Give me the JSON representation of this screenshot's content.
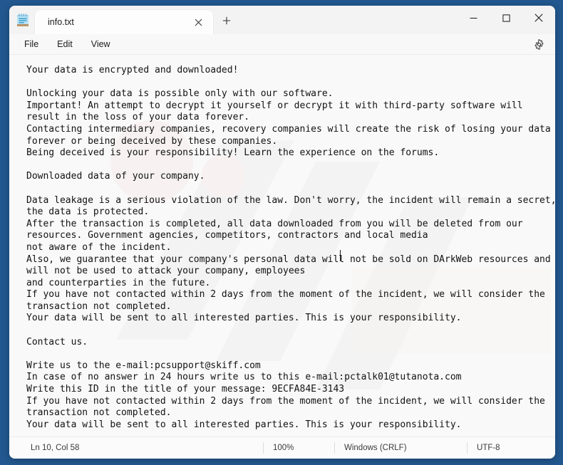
{
  "window": {
    "app_name": "Notepad",
    "app_icon": "notepad-icon",
    "tabs": [
      {
        "label": "info.txt",
        "close_icon": "close-icon",
        "active": true
      }
    ],
    "new_tab_icon": "plus-icon",
    "caption_buttons": [
      {
        "name": "minimize",
        "icon": "minimize-icon"
      },
      {
        "name": "maximize",
        "icon": "maximize-icon"
      },
      {
        "name": "close",
        "icon": "close-icon"
      }
    ]
  },
  "menubar": {
    "items": [
      {
        "label": "File"
      },
      {
        "label": "Edit"
      },
      {
        "label": "View"
      }
    ],
    "settings_icon": "gear-icon"
  },
  "editor": {
    "content": "Your data is encrypted and downloaded!\n\nUnlocking your data is possible only with our software.\nImportant! An attempt to decrypt it yourself or decrypt it with third-party software will\nresult in the loss of your data forever.\nContacting intermediary companies, recovery companies will create the risk of losing your data\nforever or being deceived by these companies.\nBeing deceived is your responsibility! Learn the experience on the forums.\n\nDownloaded data of your company.\n\nData leakage is a serious violation of the law. Don't worry, the incident will remain a secret,\nthe data is protected.\nAfter the transaction is completed, all data downloaded from you will be deleted from our\nresources. Government agencies, competitors, contractors and local media\nnot aware of the incident.\nAlso, we guarantee that your company's personal data will not be sold on DArkWeb resources and\nwill not be used to attack your company, employees\nand counterparties in the future.\nIf you have not contacted within 2 days from the moment of the incident, we will consider the\ntransaction not completed.\nYour data will be sent to all interested parties. This is your responsibility.\n\nContact us.\n\nWrite us to the e-mail:pcsupport@skiff.com\nIn case of no answer in 24 hours write us to this e-mail:pctalk01@tutanota.com\nWrite this ID in the title of your message: 9ECFA84E-3143\nIf you have not contacted within 2 days from the moment of the incident, we will consider the\ntransaction not completed.\nYour data will be sent to all interested parties. This is your responsibility.",
    "caret_line": 10,
    "caret_col": 58
  },
  "statusbar": {
    "position": "Ln 10, Col 58",
    "zoom": "100%",
    "line_ending": "Windows (CRLF)",
    "encoding": "UTF-8"
  },
  "colors": {
    "desktop": "#22588f",
    "window_bg": "#f8f8f8",
    "editor_bg": "#f9f9f9",
    "text": "#121212",
    "tab_active": "#fdfdfd"
  }
}
